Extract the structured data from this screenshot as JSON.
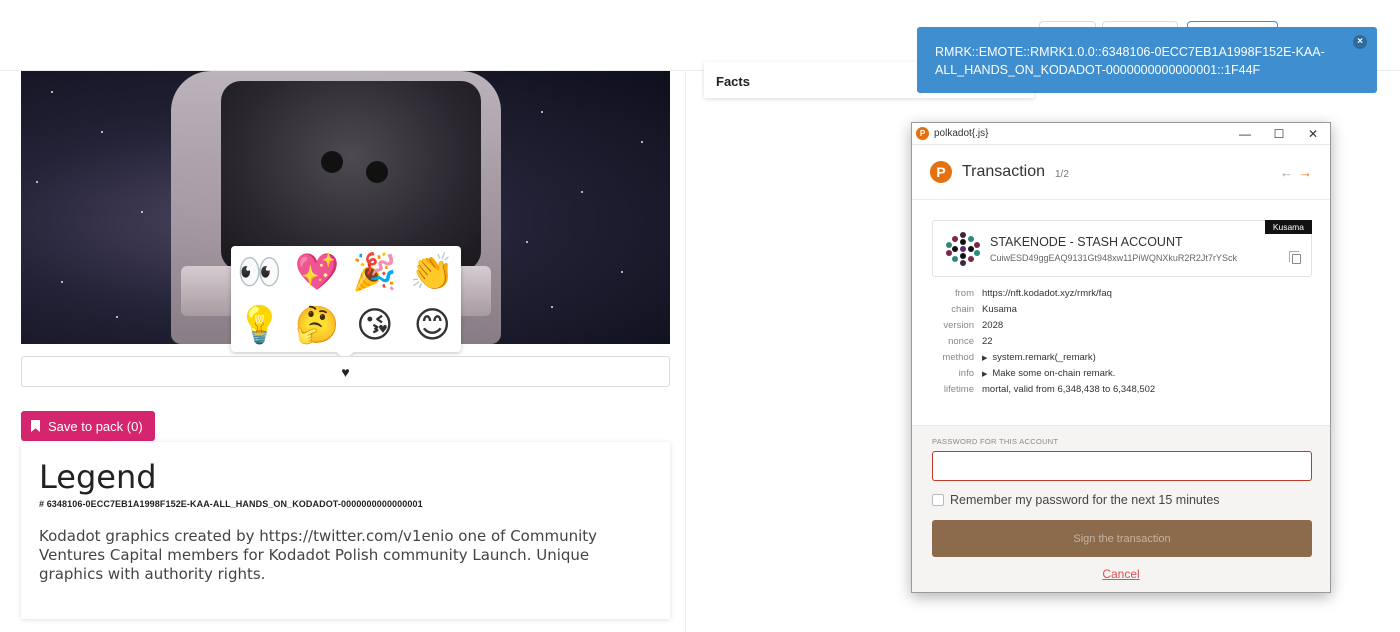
{
  "notification": {
    "message": "RMRK::EMOTE::RMRK1.0.0::6348106-0ECC7EB1A1998F152E-KAA-ALL_HANDS_ON_KODADOT-0000000000000001::1F44F",
    "close": "×"
  },
  "facts": {
    "title": "Facts"
  },
  "emoji_picker": {
    "emojis": [
      {
        "icon": "eyes-icon",
        "glyph": "👀"
      },
      {
        "icon": "sparkling-heart-icon",
        "glyph": "💖"
      },
      {
        "icon": "party-popper-icon",
        "glyph": "🎉"
      },
      {
        "icon": "clapping-hands-icon",
        "glyph": "👏"
      },
      {
        "icon": "light-bulb-icon",
        "glyph": "💡"
      },
      {
        "icon": "thinking-face-icon",
        "glyph": "🤔"
      },
      {
        "icon": "kissing-face-icon",
        "glyph": "😘"
      },
      {
        "icon": "smiling-face-icon",
        "glyph": "😊"
      }
    ]
  },
  "like_bar": {
    "icon": "heart-icon",
    "glyph": "♥"
  },
  "save_button": {
    "label": "Save to pack (0)"
  },
  "legend": {
    "title": "Legend",
    "id": "# 6348106-0ECC7EB1A1998F152E-KAA-ALL_HANDS_ON_KODADOT-0000000000000001",
    "description": "Kodadot graphics created by https://twitter.com/v1enio one of Community Ventures Capital members for Kodadot Polish community Launch. Unique graphics with authority rights."
  },
  "extension": {
    "window_title": "polkadot{.js}",
    "window_controls": {
      "minimize": "—",
      "maximize": "☐",
      "close": "✕"
    },
    "header": {
      "title": "Transaction",
      "counter": "1/2",
      "back": "←",
      "next": "→"
    },
    "account": {
      "name": "STAKENODE - STASH ACCOUNT",
      "address": "CuiwESD49ggEAQ9131Gt948xw11PiWQNXkuR2R2Jt7rYSck",
      "network": "Kusama"
    },
    "details": [
      {
        "label": "from",
        "value": "https://nft.kodadot.xyz/rmrk/faq",
        "expandable": false
      },
      {
        "label": "chain",
        "value": "Kusama",
        "expandable": false
      },
      {
        "label": "version",
        "value": "2028",
        "expandable": false
      },
      {
        "label": "nonce",
        "value": "22",
        "expandable": false
      },
      {
        "label": "method",
        "value": "system.remark(_remark)",
        "expandable": true
      },
      {
        "label": "info",
        "value": "Make some on-chain remark.",
        "expandable": true
      },
      {
        "label": "lifetime",
        "value": "mortal, valid from 6,348,438 to 6,348,502",
        "expandable": false
      }
    ],
    "password_label": "PASSWORD FOR THIS ACCOUNT",
    "password_value": "",
    "remember_label": "Remember my password for the next 15 minutes",
    "sign_label": "Sign the transaction",
    "cancel_label": "Cancel"
  },
  "colors": {
    "accent_pink": "#d6256f",
    "notification_blue": "#3e8ed0",
    "polkadot_orange": "#e6700d",
    "sign_button": "#8c6b4c"
  }
}
